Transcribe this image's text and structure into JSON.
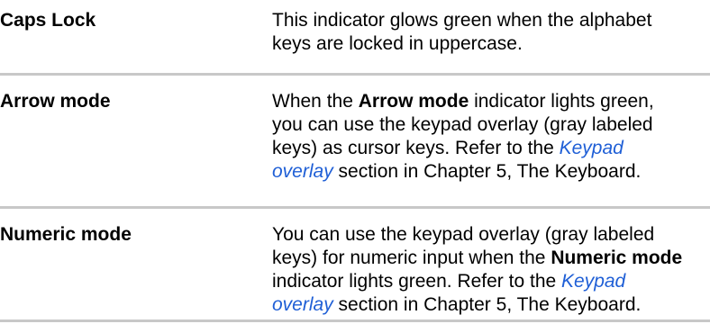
{
  "rows": [
    {
      "term": "Caps Lock",
      "lines": [
        [
          "This indicator glows green when the alphabet"
        ],
        [
          "keys are locked in uppercase."
        ]
      ]
    },
    {
      "term": "Arrow mode",
      "lines": [
        [
          "When the ",
          "Arrow mode",
          " indicator lights green,"
        ],
        [
          "you can use the keypad overlay (gray labeled"
        ],
        [
          "keys) as cursor keys. Refer to the ",
          "Keypad"
        ],
        [
          "overlay",
          " section in Chapter 5, The Keyboard."
        ]
      ]
    },
    {
      "term": "Numeric mode",
      "lines": [
        [
          "You can use the keypad overlay (gray labeled"
        ],
        [
          "keys) for numeric input when the ",
          "Numeric mode"
        ],
        [
          "indicator lights green. Refer to the ",
          "Keypad"
        ],
        [
          "overlay",
          " section in Chapter 5, The Keyboard."
        ]
      ]
    }
  ]
}
